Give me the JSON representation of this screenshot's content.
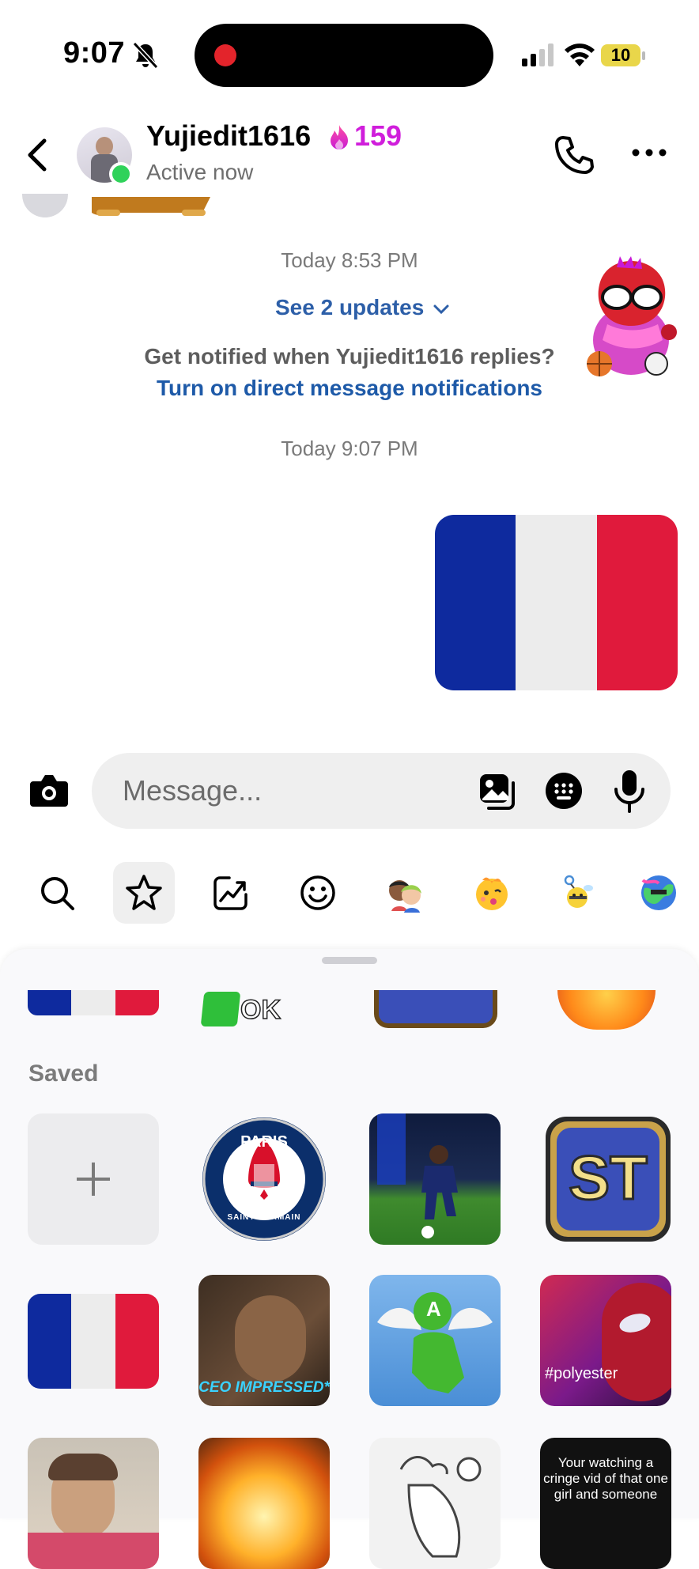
{
  "status_bar": {
    "time": "9:07",
    "battery": "10"
  },
  "header": {
    "username": "Yujiedit1616",
    "streak_count": "159",
    "status": "Active now"
  },
  "chat": {
    "timestamp_1": "Today 8:53 PM",
    "see_updates": "See 2 updates",
    "notify_prompt": "Get notified when Yujiedit1616 replies?",
    "notify_link": "Turn on direct message notifications",
    "timestamp_2": "Today 9:07 PM"
  },
  "composer": {
    "placeholder": "Message..."
  },
  "sticker_tray": {
    "partial_ok_label": "OK",
    "saved_heading": "Saved",
    "psg_top": "PARIS",
    "psg_bottom": "SAINT-GERMAIN",
    "st_label": "ST",
    "ceo_caption": "CEO IMPRESSED*",
    "angel_letter": "A",
    "spider_caption": "#polyester",
    "cringe_caption": "Your watching a cringe vid of that one girl and someone"
  },
  "colors": {
    "accent_link": "#1e5aa8",
    "streak": "#d01edb",
    "online": "#2fd25a"
  }
}
